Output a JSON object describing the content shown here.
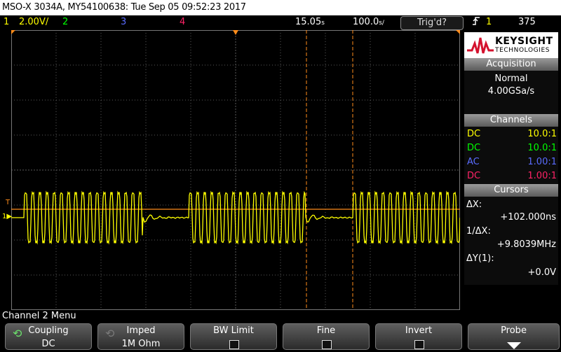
{
  "title": "MSO-X 3034A, MY54100638: Tue Sep 05 09:52:23 2017",
  "status": {
    "ch1_num": "1",
    "ch1_scale": "2.00V/",
    "ch2_num": "2",
    "ch3_num": "3",
    "ch4_num": "4",
    "time_pos": "15.05",
    "time_pos_unit": "s",
    "time_scale": "100.0",
    "time_scale_unit": "s/",
    "trig_button": "Trig'd?",
    "trig_source": "1",
    "trig_level": "375"
  },
  "markers": {
    "ground": "1",
    "trigger": "T"
  },
  "panel": {
    "logo_line1": "KEYSIGHT",
    "logo_line2": "TECHNOLOGIES",
    "acquisition": {
      "header": "Acquisition",
      "mode": "Normal",
      "rate": "4.00GSa/s"
    },
    "channels": {
      "header": "Channels",
      "rows": [
        {
          "coupling": "DC",
          "probe": "10.0:1",
          "color": "#ffff00"
        },
        {
          "coupling": "DC",
          "probe": "10.0:1",
          "color": "#00ff00"
        },
        {
          "coupling": "AC",
          "probe": "1.00:1",
          "color": "#5a6cff"
        },
        {
          "coupling": "DC",
          "probe": "1.00:1",
          "color": "#ff2266"
        }
      ]
    },
    "cursors": {
      "header": "Cursors",
      "dx_label": "ΔX:",
      "dx_value": "+102.000ns",
      "inv_label": "1/ΔX:",
      "inv_value": "+9.8039MHz",
      "dy_label": "ΔY(1):",
      "dy_value": "+0.0V"
    }
  },
  "menu": {
    "title": "Channel 2 Menu",
    "softkeys": [
      {
        "label": "Coupling",
        "value": "DC"
      },
      {
        "label": "Imped",
        "value": "1M Ohm"
      },
      {
        "label": "BW Limit"
      },
      {
        "label": "Fine"
      },
      {
        "label": "Invert"
      },
      {
        "label": "Probe"
      }
    ]
  },
  "colors": {
    "ch1": "#ffff00",
    "ch2": "#00ff00",
    "ch3": "#5a6cff",
    "ch4": "#ff2266",
    "cursor": "#ff8c1a",
    "grid": "#5a5a5a"
  },
  "icons": [
    "refresh-icon",
    "trigger-edge-icon",
    "keysight-logo-icon",
    "down-arrow-icon"
  ]
}
